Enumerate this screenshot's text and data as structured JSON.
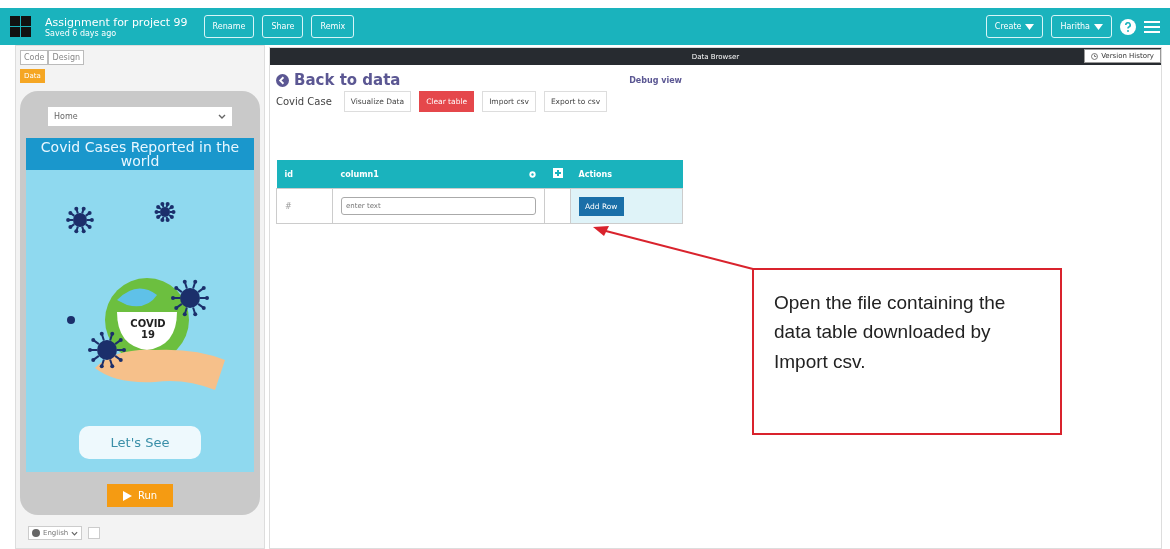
{
  "header": {
    "project_title": "Assignment for project 99",
    "saved": "Saved 6 days ago",
    "buttons": [
      "Rename",
      "Share",
      "Remix"
    ],
    "menus": [
      "Create",
      "Haritha"
    ]
  },
  "left_panel": {
    "tabs": [
      {
        "label": "Code",
        "selected": false
      },
      {
        "label": "Design",
        "selected": false
      }
    ],
    "data_button": "Data",
    "app": {
      "screen_dropdown": "Home",
      "banner": "Covid Cases Reported  in the world",
      "illustration_text": [
        "COVID",
        "19"
      ],
      "see_button": "Let's See"
    },
    "run_button": "Run",
    "language": "English"
  },
  "data_browser": {
    "title": "Data Browser",
    "version_history": "Version History",
    "back_link": "Back to data",
    "debug_link": "Debug view",
    "table_name": "Covid Case",
    "actions": [
      {
        "label": "Visualize Data",
        "kind": "plain"
      },
      {
        "label": "Clear table",
        "kind": "danger"
      },
      {
        "label": "Import csv",
        "kind": "plain"
      },
      {
        "label": "Export to csv",
        "kind": "plain"
      }
    ],
    "table": {
      "columns": [
        "id",
        "column1",
        "Actions"
      ],
      "new_row": {
        "id": "#",
        "placeholder": "enter text",
        "button": "Add Row"
      }
    }
  },
  "annotation": {
    "text": "Open the file containing the data table downloaded by Import csv."
  }
}
